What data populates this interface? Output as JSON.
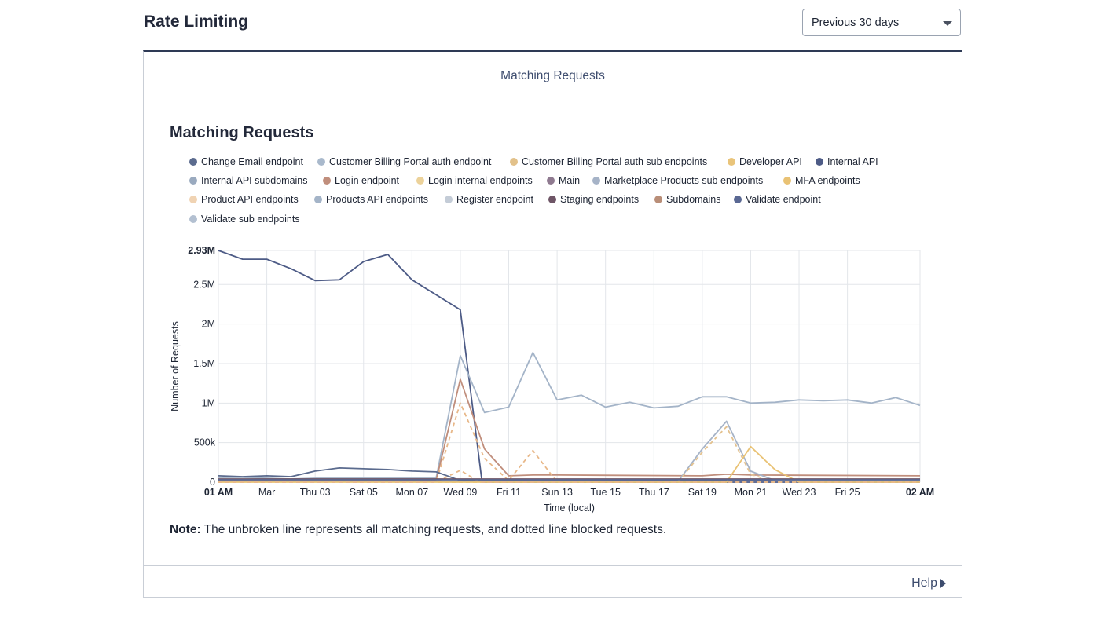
{
  "header": {
    "title": "Rate Limiting",
    "range_selected": "Previous 30 days"
  },
  "card": {
    "tab_label": "Matching Requests",
    "heading": "Matching Requests",
    "note_label": "Note:",
    "note_text": " The unbroken line represents all matching requests, and dotted line blocked requests.",
    "help_label": "Help"
  },
  "legend": [
    {
      "name": "Change Email endpoint",
      "color": "#5b6b8e"
    },
    {
      "name": "Customer Billing Portal auth endpoint",
      "color": "#a9b9cc"
    },
    {
      "name": "Customer Billing Portal auth sub endpoints",
      "color": "#e2c18a"
    },
    {
      "name": "Developer API",
      "color": "#e9c47a"
    },
    {
      "name": "Internal API",
      "color": "#4d5b86"
    },
    {
      "name": "Internal API subdomains",
      "color": "#9aaabf"
    },
    {
      "name": "Login endpoint",
      "color": "#c08e7c"
    },
    {
      "name": "Login internal endpoints",
      "color": "#ecd29a"
    },
    {
      "name": "Main",
      "color": "#8f7a90"
    },
    {
      "name": "Marketplace Products sub endpoints",
      "color": "#a6b3c7"
    },
    {
      "name": "MFA endpoints",
      "color": "#e9c274"
    },
    {
      "name": "Product API endpoints",
      "color": "#f0d3b3"
    },
    {
      "name": "Products API endpoints",
      "color": "#a4b4c8"
    },
    {
      "name": "Register endpoint",
      "color": "#c4ccd7"
    },
    {
      "name": "Staging endpoints",
      "color": "#6e5566"
    },
    {
      "name": "Subdomains",
      "color": "#b98e78"
    },
    {
      "name": "Validate endpoint",
      "color": "#5a6893"
    },
    {
      "name": "Validate sub endpoints",
      "color": "#b3c0d1"
    }
  ],
  "chart_data": {
    "type": "line",
    "ylabel": "Number of Requests",
    "xlabel": "Time (local)",
    "ylim": [
      0,
      2930000
    ],
    "y_ticks": [
      {
        "value": 0,
        "label": "0"
      },
      {
        "value": 500000,
        "label": "500k"
      },
      {
        "value": 1000000,
        "label": "1M"
      },
      {
        "value": 1500000,
        "label": "1.5M"
      },
      {
        "value": 2000000,
        "label": "2M"
      },
      {
        "value": 2500000,
        "label": "2.5M"
      },
      {
        "value": 2930000,
        "label": "2.93M",
        "bold": true
      }
    ],
    "x_ticks": [
      {
        "day": 0,
        "label": "01 AM",
        "bold": true
      },
      {
        "day": 2,
        "label": "Mar"
      },
      {
        "day": 4,
        "label": "Thu 03"
      },
      {
        "day": 6,
        "label": "Sat 05"
      },
      {
        "day": 8,
        "label": "Mon 07"
      },
      {
        "day": 10,
        "label": "Wed 09"
      },
      {
        "day": 12,
        "label": "Fri 11"
      },
      {
        "day": 14,
        "label": "Sun 13"
      },
      {
        "day": 16,
        "label": "Tue 15"
      },
      {
        "day": 18,
        "label": "Thu 17"
      },
      {
        "day": 20,
        "label": "Sat 19"
      },
      {
        "day": 22,
        "label": "Mon 21"
      },
      {
        "day": 24,
        "label": "Wed 23"
      },
      {
        "day": 26,
        "label": "Fri 25"
      },
      {
        "day": 29,
        "label": "02 AM",
        "bold": true
      }
    ],
    "xlim": [
      0,
      29
    ],
    "grid": true,
    "series": [
      {
        "name": "Internal API",
        "color": "#4d5b86",
        "dashed": false,
        "x": [
          0,
          1,
          2,
          3,
          4,
          5,
          6,
          7,
          8,
          9,
          10,
          10.9,
          11,
          29
        ],
        "y": [
          2930000,
          2820000,
          2820000,
          2700000,
          2550000,
          2560000,
          2790000,
          2880000,
          2560000,
          2370000,
          2180000,
          0,
          0,
          0
        ]
      },
      {
        "name": "Products API endpoints",
        "color": "#a4b4c8",
        "dashed": false,
        "x": [
          0,
          1,
          2,
          3,
          4,
          5,
          6,
          7,
          8,
          9,
          10,
          11,
          12,
          13,
          14,
          15,
          16,
          17,
          18,
          19,
          20,
          21,
          22,
          23,
          24,
          25,
          26,
          27,
          28,
          29
        ],
        "y": [
          60000,
          60000,
          50000,
          40000,
          50000,
          50000,
          50000,
          50000,
          50000,
          50000,
          1600000,
          880000,
          950000,
          1640000,
          1040000,
          1100000,
          950000,
          1010000,
          940000,
          960000,
          1080000,
          1080000,
          1000000,
          1010000,
          1040000,
          1030000,
          1040000,
          1000000,
          1070000,
          970000
        ]
      },
      {
        "name": "Login endpoint",
        "color": "#c08e7c",
        "dashed": false,
        "x": [
          0,
          9,
          10,
          11,
          12,
          13,
          14,
          20,
          21,
          22,
          29
        ],
        "y": [
          20000,
          20000,
          1300000,
          420000,
          80000,
          90000,
          90000,
          80000,
          100000,
          90000,
          80000
        ]
      },
      {
        "name": "Login endpoint blocked",
        "color": "#e8b889",
        "dashed": true,
        "x": [
          0,
          9,
          10,
          11,
          12,
          13,
          14,
          29
        ],
        "y": [
          0,
          0,
          1000000,
          300000,
          20000,
          400000,
          0,
          0
        ]
      },
      {
        "name": "Change Email endpoint",
        "color": "#5b6b8e",
        "dashed": false,
        "x": [
          0,
          1,
          2,
          3,
          4,
          5,
          6,
          7,
          8,
          9,
          10,
          10.8,
          29
        ],
        "y": [
          80000,
          70000,
          80000,
          70000,
          140000,
          180000,
          170000,
          160000,
          140000,
          130000,
          20000,
          20000,
          20000
        ]
      },
      {
        "name": "Marketplace Products sub endpoints",
        "color": "#a6b3c7",
        "dashed": false,
        "x": [
          0,
          19,
          20,
          21,
          22,
          23,
          29
        ],
        "y": [
          10000,
          10000,
          420000,
          770000,
          140000,
          20000,
          20000
        ]
      },
      {
        "name": "Marketplace Products sub endpoints blocked",
        "color": "#e3c18e",
        "dashed": true,
        "x": [
          0,
          19,
          20,
          21,
          22,
          23,
          29
        ],
        "y": [
          0,
          0,
          380000,
          700000,
          100000,
          0,
          0
        ]
      },
      {
        "name": "MFA endpoints",
        "color": "#e9c274",
        "dashed": false,
        "x": [
          0,
          21,
          22,
          23,
          24,
          25,
          29
        ],
        "y": [
          0,
          0,
          450000,
          160000,
          0,
          0,
          0
        ]
      },
      {
        "name": "Product API endpoints",
        "color": "#e8b889",
        "dashed": true,
        "x": [
          0,
          9,
          10,
          10.8,
          29
        ],
        "y": [
          0,
          0,
          150000,
          0,
          0
        ]
      },
      {
        "name": "Staging endpoints",
        "color": "#6e5566",
        "dashed": false,
        "x": [
          0,
          29
        ],
        "y": [
          40000,
          40000
        ]
      },
      {
        "name": "Validate endpoint",
        "color": "#5a6893",
        "dashed": false,
        "x": [
          0,
          29
        ],
        "y": [
          30000,
          30000
        ]
      }
    ]
  }
}
